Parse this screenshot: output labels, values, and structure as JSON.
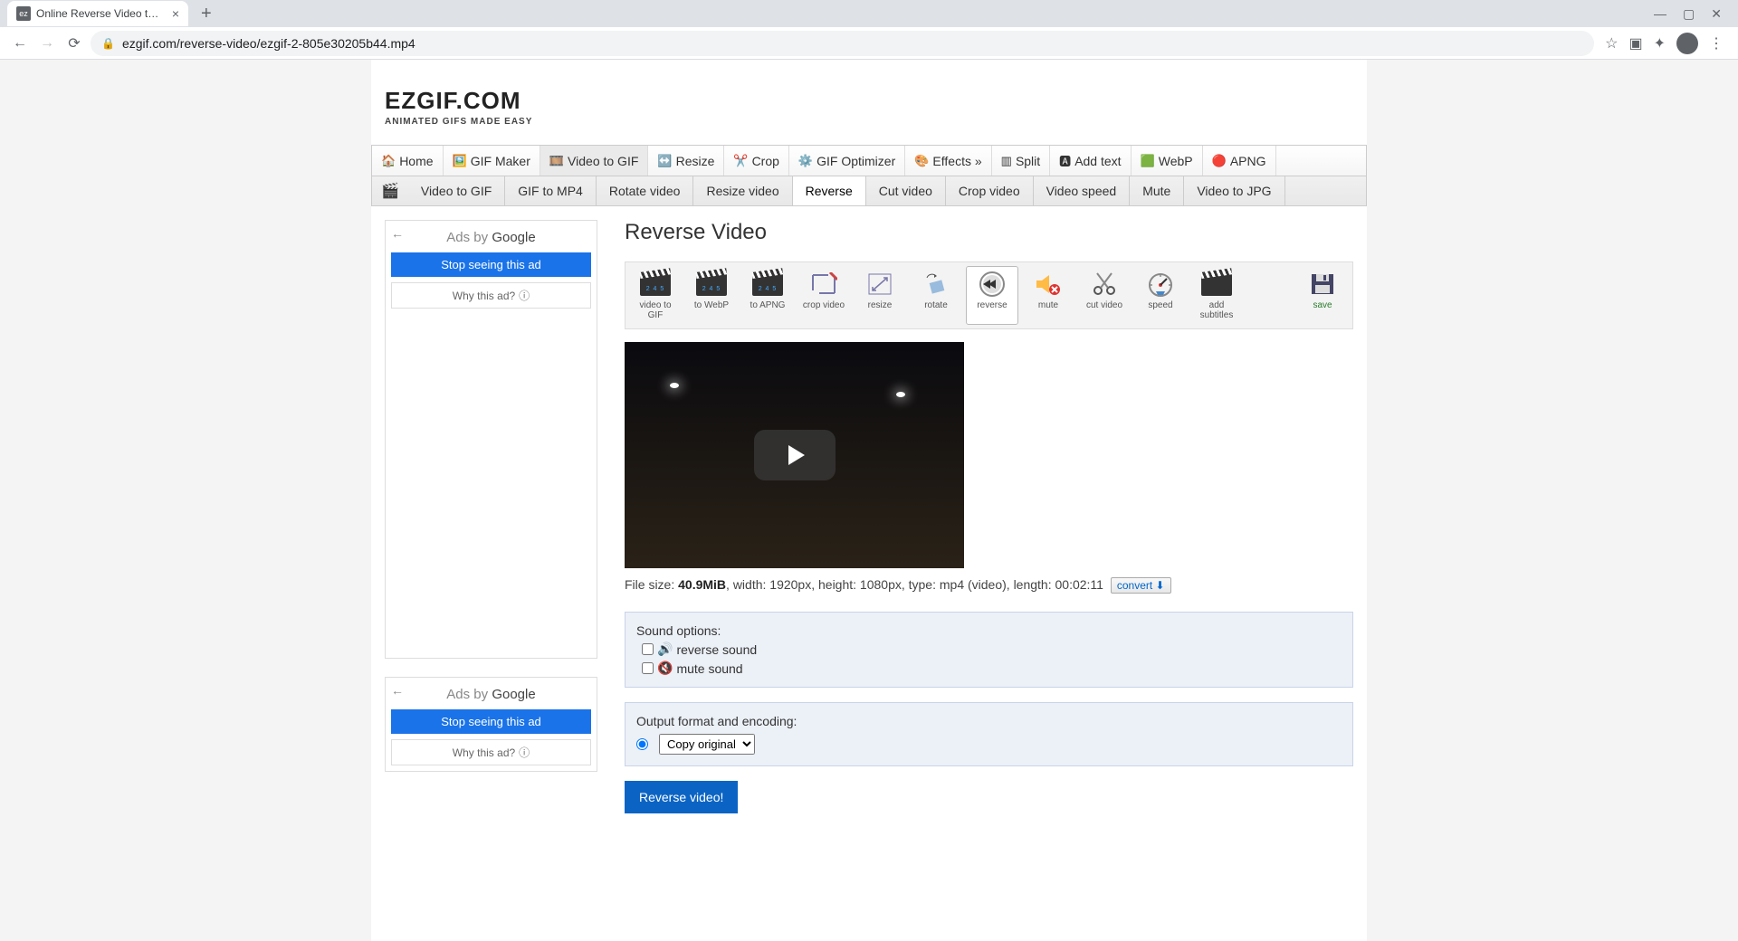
{
  "browser": {
    "tab_title": "Online Reverse Video tool - Won",
    "url": "ezgif.com/reverse-video/ezgif-2-805e30205b44.mp4"
  },
  "site": {
    "logo_main": "EZGIF.COM",
    "logo_tag": "ANIMATED GIFS MADE EASY"
  },
  "main_nav": [
    {
      "icon": "🏠",
      "label": "Home"
    },
    {
      "icon": "🖼️",
      "label": "GIF Maker"
    },
    {
      "icon": "🎞️",
      "label": "Video to GIF",
      "active": true
    },
    {
      "icon": "↔️",
      "label": "Resize"
    },
    {
      "icon": "✂️",
      "label": "Crop"
    },
    {
      "icon": "⚙️",
      "label": "GIF Optimizer"
    },
    {
      "icon": "🎨",
      "label": "Effects »"
    },
    {
      "icon": "▥",
      "label": "Split"
    },
    {
      "icon": "🅰",
      "label": "Add text"
    },
    {
      "icon": "🟩",
      "label": "WebP"
    },
    {
      "icon": "🔴",
      "label": "APNG"
    }
  ],
  "sub_nav": [
    {
      "label": "Video to GIF"
    },
    {
      "label": "GIF to MP4"
    },
    {
      "label": "Rotate video"
    },
    {
      "label": "Resize video"
    },
    {
      "label": "Reverse",
      "active": true
    },
    {
      "label": "Cut video"
    },
    {
      "label": "Crop video"
    },
    {
      "label": "Video speed"
    },
    {
      "label": "Mute"
    },
    {
      "label": "Video to JPG"
    }
  ],
  "ads": {
    "header": "Ads by ",
    "google": "Google",
    "stop": "Stop seeing this ad",
    "why": "Why this ad?"
  },
  "page_title": "Reverse Video",
  "tools": [
    {
      "label": "video to GIF",
      "icon": "clap"
    },
    {
      "label": "to WebP",
      "icon": "clap"
    },
    {
      "label": "to APNG",
      "icon": "clap"
    },
    {
      "label": "crop video",
      "icon": "crop"
    },
    {
      "label": "resize",
      "icon": "resize"
    },
    {
      "label": "rotate",
      "icon": "rotate"
    },
    {
      "label": "reverse",
      "icon": "reverse",
      "active": true
    },
    {
      "label": "mute",
      "icon": "mute"
    },
    {
      "label": "cut video",
      "icon": "cut"
    },
    {
      "label": "speed",
      "icon": "speed"
    },
    {
      "label": "add subtitles",
      "icon": "subtitles"
    },
    {
      "label": "save",
      "icon": "save",
      "save": true
    }
  ],
  "file_info": {
    "prefix": "File size: ",
    "size": "40.9MiB",
    "rest": ", width: 1920px, height: 1080px, type: mp4 (video), length: 00:02:11",
    "convert": "convert"
  },
  "sound": {
    "title": "Sound options:",
    "opt1": "reverse sound",
    "opt2": "mute sound"
  },
  "output": {
    "title": "Output format and encoding:",
    "selected": "Copy original"
  },
  "submit": "Reverse video!"
}
